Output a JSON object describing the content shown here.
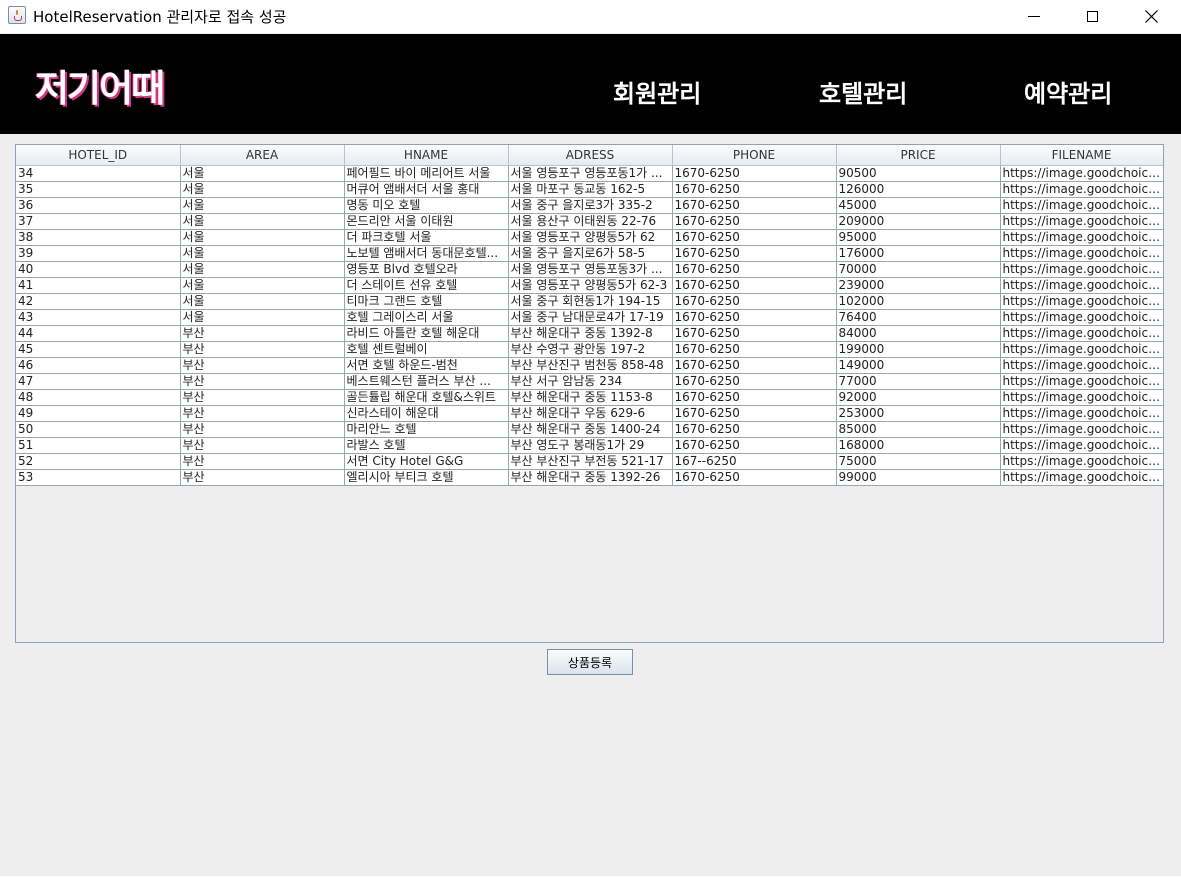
{
  "window": {
    "title": "HotelReservation 관리자로 접속 성공",
    "controls": [
      "minimize-icon",
      "maximize-icon",
      "close-icon"
    ]
  },
  "header": {
    "logo": "저기어때",
    "nav": [
      "회원관리",
      "호텔관리",
      "예약관리"
    ]
  },
  "colors": {
    "header_bg": "#000000",
    "logo_shadow": "#d63384",
    "body_bg": "#eeeeee"
  },
  "table": {
    "columns": [
      "HOTEL_ID",
      "AREA",
      "HNAME",
      "ADRESS",
      "PHONE",
      "PRICE",
      "FILENAME"
    ],
    "rows": [
      [
        "34",
        "서울",
        "페어필드 바이 메리어트 서울",
        "서울 영등포구 영등포동1가 ...",
        "1670-6250",
        "90500",
        "https://image.goodchoice.kr..."
      ],
      [
        "35",
        "서울",
        "머큐어 앰배서더 서울 홍대",
        "서울 마포구 동교동 162-5",
        "1670-6250",
        "126000",
        "https://image.goodchoice.kr..."
      ],
      [
        "36",
        "서울",
        "명동 미오 호텔",
        "서울 중구 을지로3가 335-2",
        "1670-6250",
        "45000",
        "https://image.goodchoice.kr..."
      ],
      [
        "37",
        "서울",
        "몬드리안 서울 이태원",
        "서울 용산구 이태원동 22-76",
        "1670-6250",
        "209000",
        "https://image.goodchoice.kr..."
      ],
      [
        "38",
        "서울",
        "더 파크호텔 서울",
        "서울 영등포구 양평동5가 62",
        "1670-6250",
        "95000",
        "https://image.goodchoice.kr..."
      ],
      [
        "39",
        "서울",
        "노보텔 앰배서더 동대문호텔...",
        "서울 중구 을지로6가 58-5",
        "1670-6250",
        "176000",
        "https://image.goodchoice.kr..."
      ],
      [
        "40",
        "서울",
        "영등포 Blvd 호텔오라",
        "서울 영등포구 영등포동3가 ...",
        "1670-6250",
        "70000",
        "https://image.goodchoice.kr..."
      ],
      [
        "41",
        "서울",
        "더 스테이트 선유 호텔",
        "서울 영등포구 양평동5가 62-3",
        "1670-6250",
        "239000",
        "https://image.goodchoice.kr..."
      ],
      [
        "42",
        "서울",
        "티마크 그랜드 호텔",
        "서울 중구 회현동1가 194-15",
        "1670-6250",
        "102000",
        "https://image.goodchoice.kr..."
      ],
      [
        "43",
        "서울",
        "호텔 그레이스리 서울",
        "서울 중구 남대문로4가 17-19",
        "1670-6250",
        "76400",
        "https://image.goodchoice.kr..."
      ],
      [
        "44",
        "부산",
        "라비드 아틀란 호텔 해운대",
        "부산 해운대구 중동 1392-8",
        "1670-6250",
        "84000",
        "https://image.goodchoice.kr..."
      ],
      [
        "45",
        "부산",
        "호텔 센트럴베이",
        "부산 수영구 광안동 197-2",
        "1670-6250",
        "199000",
        "https://image.goodchoice.kr..."
      ],
      [
        "46",
        "부산",
        "서면 호텔 하운드-범천",
        "부산 부산진구 범천동 858-48",
        "1670-6250",
        "149000",
        "https://image.goodchoice.kr..."
      ],
      [
        "47",
        "부산",
        "베스트웨스턴 플러스 부산 ...",
        "부산 서구 암남동 234",
        "1670-6250",
        "77000",
        "https://image.goodchoice.kr..."
      ],
      [
        "48",
        "부산",
        "골든튤립 해운대 호텔&스위트",
        "부산 해운대구 중동 1153-8",
        "1670-6250",
        "92000",
        "https://image.goodchoice.kr..."
      ],
      [
        "49",
        "부산",
        "신라스테이 해운대",
        "부산 해운대구 우동 629-6",
        "1670-6250",
        "253000",
        "https://image.goodchoice.kr..."
      ],
      [
        "50",
        "부산",
        "마리안느 호텔",
        "부산 해운대구 중동 1400-24",
        "1670-6250",
        "85000",
        "https://image.goodchoice.kr..."
      ],
      [
        "51",
        "부산",
        "라발스 호텔",
        "부산 영도구 봉래동1가 29",
        "1670-6250",
        "168000",
        "https://image.goodchoice.kr..."
      ],
      [
        "52",
        "부산",
        "서면 City Hotel G&G",
        "부산 부산진구 부전동 521-17",
        "167--6250",
        "75000",
        "https://image.goodchoice.kr..."
      ],
      [
        "53",
        "부산",
        "엘리시아 부티크 호텔",
        "부산 해운대구 중동 1392-26",
        "1670-6250",
        "99000",
        "https://image.goodchoice.kr..."
      ]
    ]
  },
  "actions": {
    "register": "상품등록"
  }
}
